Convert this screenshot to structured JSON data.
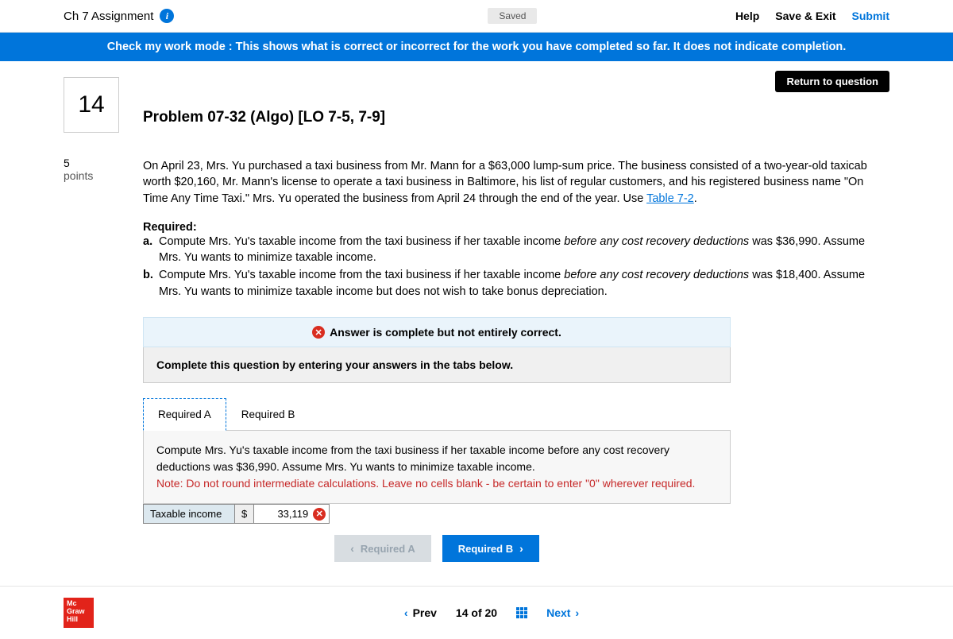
{
  "header": {
    "assignment": "Ch 7 Assignment",
    "saved": "Saved",
    "help": "Help",
    "save_exit": "Save & Exit",
    "submit": "Submit"
  },
  "banner": "Check my work mode : This shows what is correct or incorrect for the work you have completed so far. It does not indicate completion.",
  "return_btn": "Return to question",
  "question": {
    "number": "14",
    "points_value": "5",
    "points_label": "points",
    "title": "Problem 07-32 (Algo) [LO 7-5, 7-9]",
    "body_part1": "On April 23, Mrs. Yu purchased a taxi business from Mr. Mann for a $63,000 lump-sum price. The business consisted of a two-year-old taxicab worth $20,160, Mr. Mann's license to operate a taxi business in Baltimore, his list of regular customers, and his registered business name \"On Time Any Time Taxi.\" Mrs. Yu operated the business from April 24 through the end of the year. Use ",
    "table_link": "Table 7-2",
    "body_part2": ".",
    "required_label": "Required:",
    "req_a_marker": "a.",
    "req_a_1": "Compute Mrs. Yu's taxable income from the taxi business if her taxable income ",
    "req_a_italic": "before any cost recovery deductions",
    "req_a_2": " was $36,990. Assume Mrs. Yu wants to minimize taxable income.",
    "req_b_marker": "b.",
    "req_b_1": "Compute Mrs. Yu's taxable income from the taxi business if her taxable income ",
    "req_b_italic": "before any cost recovery deductions",
    "req_b_2": " was $18,400. Assume Mrs. Yu wants to minimize taxable income but does not wish to take bonus depreciation."
  },
  "status": "Answer is complete but not entirely correct.",
  "instruction": "Complete this question by entering your answers in the tabs below.",
  "tabs": {
    "a": "Required A",
    "b": "Required B"
  },
  "tab_content": {
    "prompt": "Compute Mrs. Yu's taxable income from the taxi business if her taxable income before any cost recovery deductions was $36,990. Assume Mrs. Yu wants to minimize taxable income.",
    "note": "Note: Do not round intermediate calculations. Leave no cells blank - be certain to enter \"0\" wherever required."
  },
  "answer": {
    "label": "Taxable income",
    "currency": "$",
    "value": "33,119"
  },
  "bottom_nav": {
    "prev_tab": "Required A",
    "next_tab": "Required B"
  },
  "footer": {
    "logo_l1": "Mc",
    "logo_l2": "Graw",
    "logo_l3": "Hill",
    "prev": "Prev",
    "position_cur": "14",
    "position_sep": "of",
    "position_total": "20",
    "next": "Next"
  }
}
